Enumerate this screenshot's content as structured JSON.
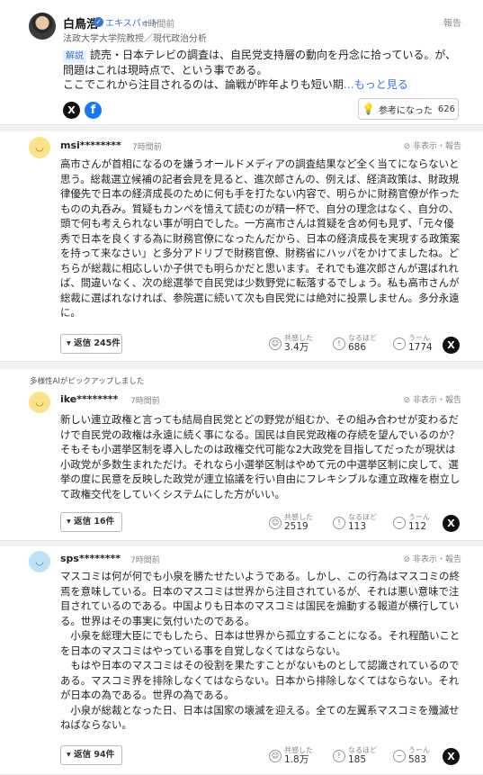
{
  "expert": {
    "name": "白鳥浩",
    "badge": "エキスパート",
    "time": "4時間前",
    "title": "法政大学大学院教授／現代政治分析",
    "report": "報告",
    "tag": "解説",
    "text1": "読売・日本テレビの調査は、自民党支持層の動向を丹念に拾っている。が、問題はこれは現時点で、という事である。",
    "text2": "ここでこれから注目されるのは、論戦が昨年よりも短い期",
    "more": "…もっと見る",
    "helpful_label": "参考になった",
    "helpful_count": "626"
  },
  "comment_actions": "非表示・報告",
  "comments": [
    {
      "user": "msi********",
      "time": "7時間前",
      "text": "高市さんが首相になるのを嫌うオールドメディアの調査結果など全く当てにならないと思う。総裁選立候補の記者会見を見ると、進次郎さんの、例えば、経済政策は、財政規律優先で日本の経済成長のために何も手を打たない内容で、明らかに財務官僚が作ったものの丸呑み。質疑もカンペを憶えて読むのが精一杯で、自分の理念はなく、自分の、頭で何も考えられない事が明白でした。一方高市さんは質疑を含め何も見ず、「元々優秀で日本を良くする為に財務官僚になったんだから、日本の経済成長を実現する政策案を持って来なさい」と多分アドリブで財務官僚、財務省にハッパをかけてましたね。どちらが総裁に相応しいか子供でも明らかだと思います。それでも進次郎さんが選ばれれば、間違いなく、次の総選挙で自民党は少数野党に転落するでしょう。私も高市さんが総裁に選ばれなければ、参院選に続いて次も自民党には絶対に投票しません。多分永遠に。",
      "replies": "返信 245件",
      "empathy": "3.4万",
      "naruhodo": "686",
      "uun": "1774"
    },
    {
      "pickup": "多様性AIがピックアップしました",
      "user": "ike********",
      "time": "7時間前",
      "text": "新しい連立政権と言っても結局自民党とどの野党が組むか、その組み合わせが変わるだけで自民党の政権は永遠に続く事になる。国民は自民党政権の存続を望んでいるのか？そもそも小選挙区制を導入したのは政権交代可能な2大政党を目指してだったが現状は小政党が多数生まれただけ。それなら小選挙区制はやめて元の中選挙区制に戻して、選挙の度に民意を反映した政党が連立協議を行い自由にフレキシブルな連立政権を樹立して政権交代をしていくシステムにした方がいい。",
      "replies": "返信 16件",
      "empathy": "2519",
      "naruhodo": "113",
      "uun": "112"
    },
    {
      "user": "sps********",
      "time": "7時間前",
      "paragraphs": [
        "マスコミは何が何でも小泉を勝たせたいようである。しかし、この行為はマスコミの終焉を意味している。日本のマスコミは世界から注目されているが、それは悪い意味で注目されているのである。中国よりも日本のマスコミは国民を煽動する報道が横行している。世界はその事実に気付いたのである。",
        "　小泉を総理大臣にでもしたら、日本は世界から孤立することになる。それ程酷いことを日本のマスコミはやっている事を自覚しなくてはならない。",
        "　もはや日本のマスコミはその役割を果たすことがないものとして認識されているのである。マスコミ界を排除しなくてはならない。日本から排除しなくてはならない。それが日本の為である。世界の為である。",
        "　小泉が総裁となった日、日本は国家の壊滅を迎える。全ての左翼系マスコミを殲滅せねばならない。"
      ],
      "replies": "返信 94件",
      "empathy": "1.8万",
      "naruhodo": "185",
      "uun": "583"
    }
  ],
  "reaction_labels": {
    "empathy": "共感した",
    "naruhodo": "なるほど",
    "uun": "うーん"
  },
  "share_x": "X",
  "share_fb": "f"
}
